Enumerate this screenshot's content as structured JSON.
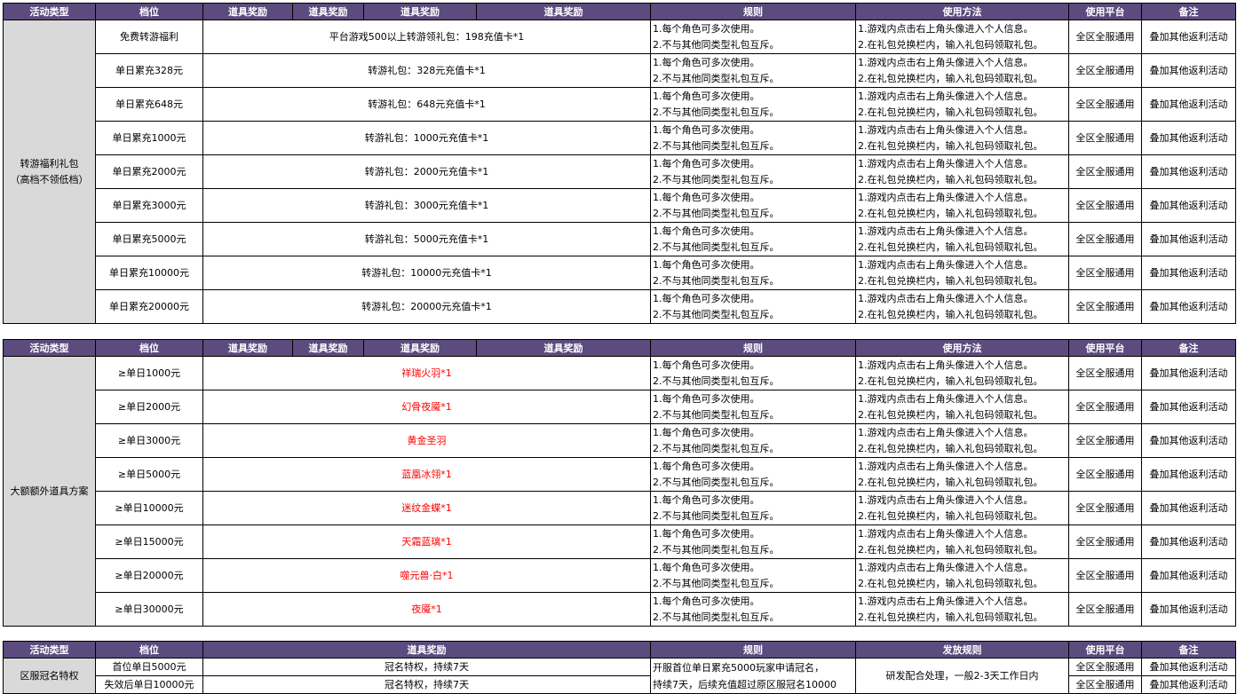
{
  "headers": {
    "activity_type": "活动类型",
    "tier": "档位",
    "item_reward": "道具奖励",
    "rules": "规则",
    "usage": "使用方法",
    "platform": "使用平台",
    "note": "备注",
    "distribution_rules": "发放规则"
  },
  "section1": {
    "category": [
      "转游福利礼包",
      "（高档不领低档）"
    ],
    "rows": [
      {
        "tier": "免费转游福利",
        "reward": "平台游戏500以上转游领礼包：198充值卡*1"
      },
      {
        "tier": "单日累充328元",
        "reward": "转游礼包：328元充值卡*1"
      },
      {
        "tier": "单日累充648元",
        "reward": "转游礼包：648元充值卡*1"
      },
      {
        "tier": "单日累充1000元",
        "reward": "转游礼包：1000元充值卡*1"
      },
      {
        "tier": "单日累充2000元",
        "reward": "转游礼包：2000元充值卡*1"
      },
      {
        "tier": "单日累充3000元",
        "reward": "转游礼包：3000元充值卡*1"
      },
      {
        "tier": "单日累充5000元",
        "reward": "转游礼包：5000元充值卡*1"
      },
      {
        "tier": "单日累充10000元",
        "reward": "转游礼包：10000元充值卡*1"
      },
      {
        "tier": "单日累充20000元",
        "reward": "转游礼包：20000元充值卡*1"
      }
    ]
  },
  "section2": {
    "category": "大额额外道具方案",
    "rows": [
      {
        "tier": "≥单日1000元",
        "reward": "祥瑞火羽*1"
      },
      {
        "tier": "≥单日2000元",
        "reward": "幻骨夜魇*1"
      },
      {
        "tier": "≥单日3000元",
        "reward": "黄金圣羽"
      },
      {
        "tier": "≥单日5000元",
        "reward": "蓝凰冰翎*1"
      },
      {
        "tier": "≥单日10000元",
        "reward": "迷纹金蝶*1"
      },
      {
        "tier": "≥单日15000元",
        "reward": "天霜蓝璃*1"
      },
      {
        "tier": "≥单日20000元",
        "reward": "噬元兽·白*1"
      },
      {
        "tier": "≥单日30000元",
        "reward": "夜魇*1"
      }
    ]
  },
  "common": {
    "rule1": "1.每个角色可多次使用。",
    "rule2": "2.不与其他同类型礼包互斥。",
    "usage1": "1.游戏内点击右上角头像进入个人信息。",
    "usage2": "2.在礼包兑换栏内，输入礼包码领取礼包。",
    "platform": "全区全服通用",
    "note": "叠加其他返利活动"
  },
  "section3": {
    "category": "区服冠名特权",
    "rows": [
      {
        "tier": "首位单日5000元",
        "reward": "冠名特权，持续7天"
      },
      {
        "tier": "失效后单日10000元",
        "reward": "冠名特权，持续7天"
      }
    ],
    "rule_line1": "开服首位单日累充5000玩家申请冠名，",
    "rule_line2": "持续7天，后续充值超过原区服冠名10000",
    "distribution": "研发配合处理，一般2-3天工作日内",
    "platform": "全区全服通用",
    "note": "叠加其他返利活动"
  },
  "colors": {
    "header_bg": "#5b4b7e",
    "category_bg": "#d9d9d9",
    "reward_red": "#ff0000"
  }
}
